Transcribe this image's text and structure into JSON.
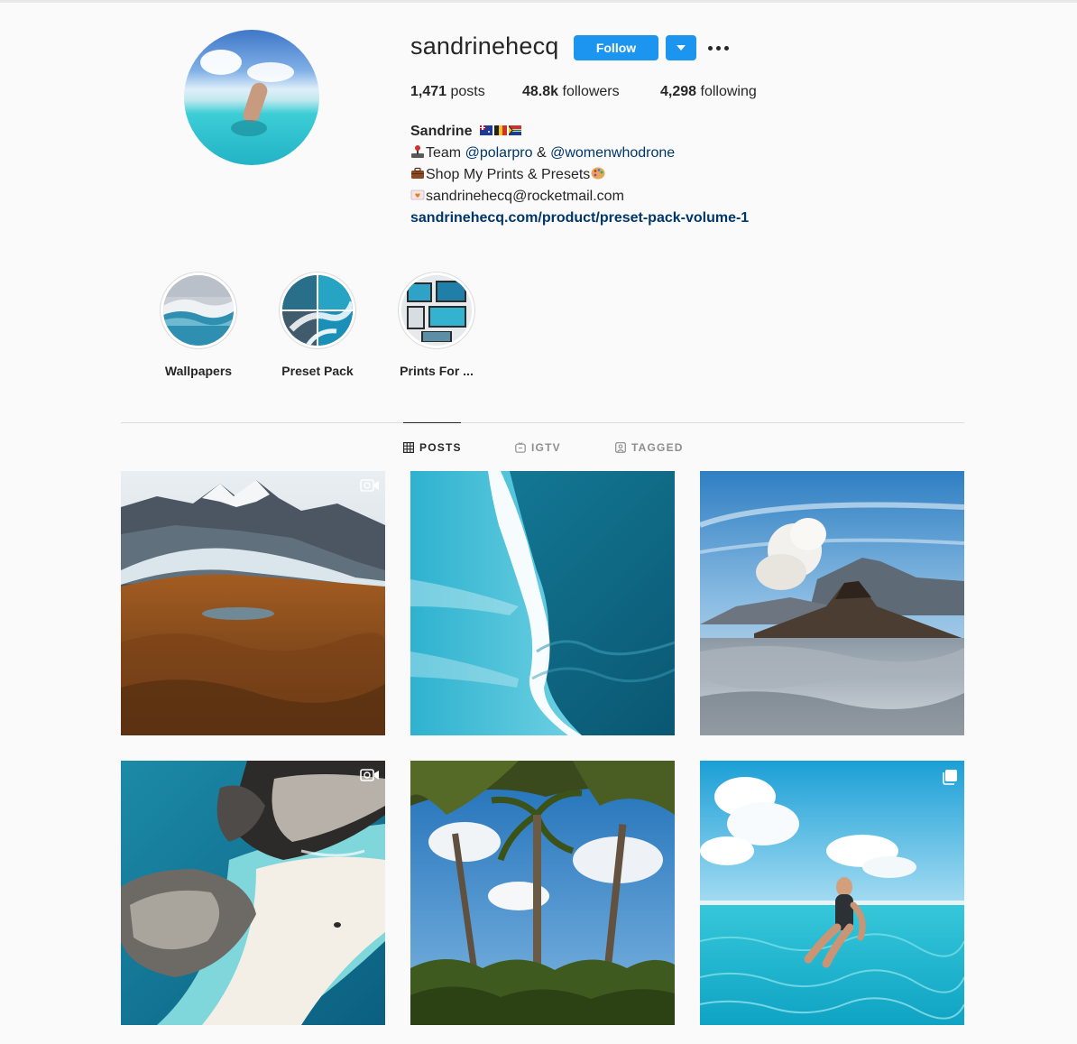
{
  "profile": {
    "username": "sandrinehecq",
    "follow_label": "Follow",
    "stats": [
      {
        "value": "1,471",
        "label": "posts"
      },
      {
        "value": "48.8k",
        "label": "followers"
      },
      {
        "value": "4,298",
        "label": "following"
      }
    ],
    "bio": {
      "name": "Sandrine",
      "line1_prefix": "Team ",
      "line1_link1": "@polarpro",
      "line1_mid": " & ",
      "line1_link2": "@womenwhodrone",
      "line2": "Shop My Prints & Presets",
      "line3": "sandrinehecq@rocketmail.com",
      "website": "sandrinehecq.com/product/preset-pack-volume-1"
    }
  },
  "highlights": [
    {
      "label": "Wallpapers"
    },
    {
      "label": "Preset Pack"
    },
    {
      "label": "Prints For ..."
    }
  ],
  "tabs": [
    {
      "label": "POSTS",
      "active": true
    },
    {
      "label": "IGTV",
      "active": false
    },
    {
      "label": "TAGGED",
      "active": false
    }
  ],
  "posts": [
    {
      "subject": "glacier and mountains",
      "badge": "igtv"
    },
    {
      "subject": "aerial ocean wave",
      "badge": ""
    },
    {
      "subject": "volcano above clouds",
      "badge": ""
    },
    {
      "subject": "aerial rocks and beach",
      "badge": "igtv"
    },
    {
      "subject": "palm trees from below",
      "badge": ""
    },
    {
      "subject": "woman in turquoise sea",
      "badge": "carousel"
    }
  ],
  "colors": {
    "accent": "#1c95f0",
    "link": "#00376b",
    "text": "#262626",
    "muted": "#8e8e8e",
    "background": "#fafafa"
  }
}
